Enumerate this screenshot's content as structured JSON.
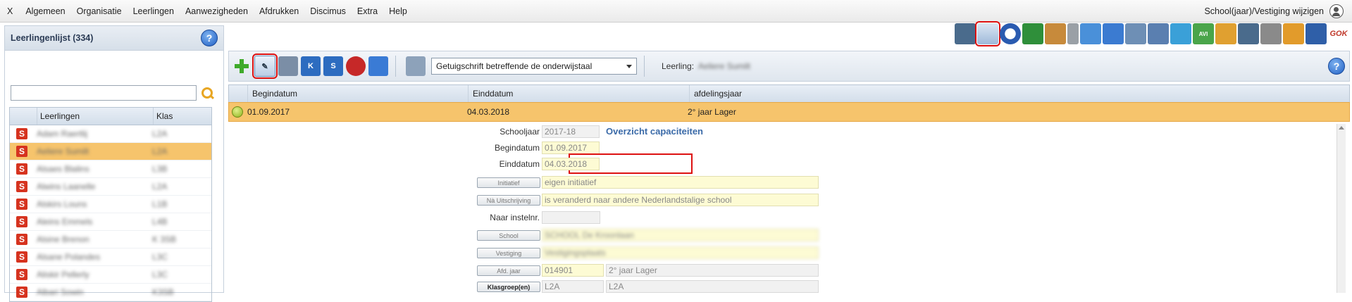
{
  "menu": {
    "items": [
      "X",
      "Algemeen",
      "Organisatie",
      "Leerlingen",
      "Aanwezigheden",
      "Afdrukken",
      "Discimus",
      "Extra",
      "Help"
    ],
    "school_change": "School(jaar)/Vestiging wijzigen"
  },
  "icon_strip": [
    "id-card-icon",
    "edit-document-icon",
    "clock-icon",
    "notebook-icon",
    "house-hand-icon",
    "phone-icon",
    "mail-icon",
    "users-icon",
    "register-icon",
    "school-building-icon",
    "ruler-icon",
    "avi-icon",
    "dancer-icon",
    "student-card-icon",
    "certificate-icon",
    "steps-icon",
    "user-clock-icon",
    "gok-icon"
  ],
  "icon_strip_texts": {
    "avi": "AVI",
    "gok": "GOK"
  },
  "left_panel": {
    "title": "Leerlingenlijst (334)",
    "search_value": "",
    "columns": [
      "Leerlingen",
      "Klas"
    ],
    "rows": [
      {
        "name": "Adam Raertlij",
        "klas": "L2A"
      },
      {
        "name": "Aeliere Sumilt",
        "klas": "L2A"
      },
      {
        "name": "Alsaes Blalins",
        "klas": "L3B"
      },
      {
        "name": "Alwins Laanelle",
        "klas": "L2A"
      },
      {
        "name": "Alskirs Louns",
        "klas": "L1B"
      },
      {
        "name": "Aleins Emmels",
        "klas": "L4B"
      },
      {
        "name": "Alsine Brenon",
        "klas": "K 3SB"
      },
      {
        "name": "Alsane Polandes",
        "klas": "L3C"
      },
      {
        "name": "Aliskir Pellerly",
        "klas": "L3C"
      },
      {
        "name": "Albari Sowin",
        "klas": "K3SB"
      }
    ]
  },
  "toolbar": {
    "k_label": "K",
    "s_label": "S",
    "document_select": "Getuigschrift betreffende de onderwijstaal",
    "leerling_label": "Leerling:",
    "leerling_value": "Aeliere Sumilt"
  },
  "grid": {
    "columns": [
      "Begindatum",
      "Einddatum",
      "afdelingsjaar"
    ],
    "row": {
      "begin": "01.09.2017",
      "eind": "04.03.2018",
      "afdeling": "2° jaar Lager"
    }
  },
  "form": {
    "schooljaar_label": "Schooljaar",
    "schooljaar": "2017-18",
    "overview_title": "Overzicht capaciteiten",
    "begindatum_label": "Begindatum",
    "begindatum": "01.09.2017",
    "einddatum_label": "Einddatum",
    "einddatum": "04.03.2018",
    "initiatief_btn": "Initiatief",
    "initiatief": "eigen initiatief",
    "na_btn": "Nà Uitschrijving",
    "na_uitschrijving": "is veranderd naar andere Nederlandstalige school",
    "naar_label": "Naar instelnr.",
    "naar_instelnr": "",
    "school_btn": "School",
    "school": "SCHOOL De Kroonlaan",
    "vestiging_btn": "Vestiging",
    "vestiging": "Vestigingsplaats",
    "afd_jaar_btn": "Afd. jaar",
    "afd_jaar_code": "014901",
    "afd_jaar_text": "2° jaar Lager",
    "klasgroep_btn": "Klasgroep(en)",
    "klasgroep": "L2A",
    "klasgroep2": "L2A"
  }
}
